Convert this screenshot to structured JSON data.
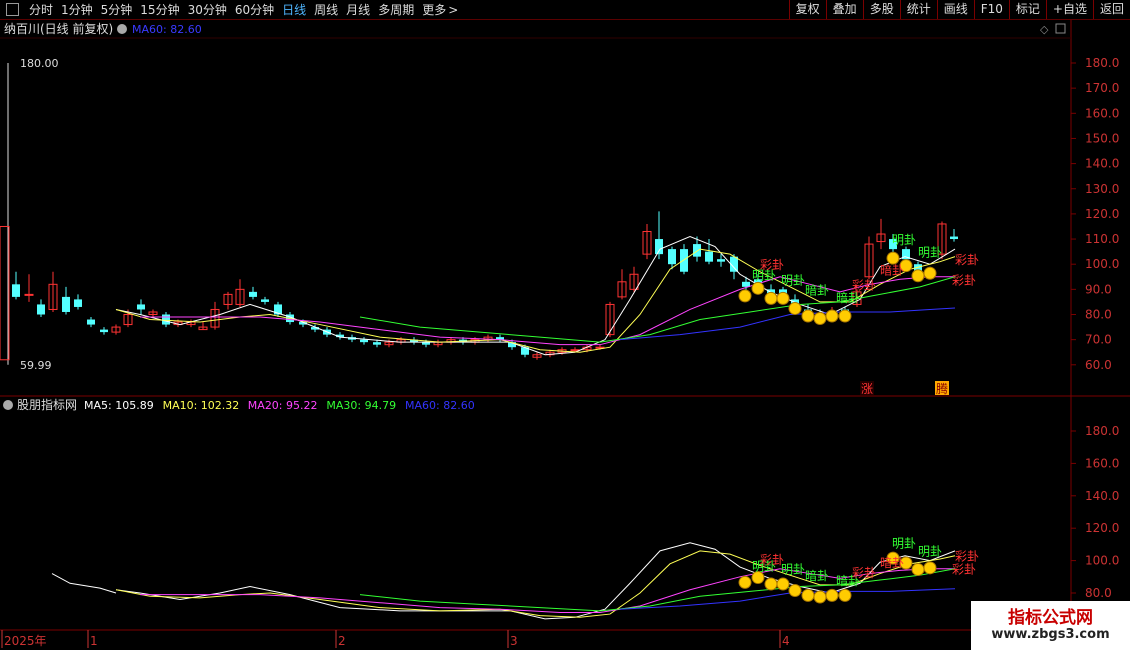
{
  "toolbar": {
    "periods": [
      "分时",
      "1分钟",
      "5分钟",
      "15分钟",
      "30分钟",
      "60分钟",
      "日线",
      "周线",
      "月线",
      "多周期",
      "更多"
    ],
    "active_period": "日线",
    "more_arrow": ">",
    "buttons": [
      "复权",
      "叠加",
      "多股",
      "统计",
      "画线",
      "F10",
      "标记",
      "+自选",
      "返回"
    ]
  },
  "main_panel": {
    "stock_title": "纳百川(日线 前复权)",
    "ma_label": "MA60: 82.60",
    "max_marker": "180.00",
    "min_marker": "59.99",
    "y_ticks": [
      "180.0",
      "170.0",
      "160.0",
      "150.0",
      "140.0",
      "130.0",
      "120.0",
      "110.0",
      "100.0",
      "90.0",
      "80.0",
      "70.0",
      "60.0"
    ],
    "tag_zhang": "涨",
    "tag_teng": "腾"
  },
  "indicator_panel": {
    "name": "股朋指标网",
    "ma_legend": [
      {
        "text": "MA5: 105.89",
        "color": "#ffffff"
      },
      {
        "text": "MA10: 102.32",
        "color": "#ffff55"
      },
      {
        "text": "MA20: 95.22",
        "color": "#ff44ff"
      },
      {
        "text": "MA30: 94.79",
        "color": "#33ff33"
      },
      {
        "text": "MA60: 82.60",
        "color": "#3333ff"
      }
    ],
    "y_ticks": [
      "180.0",
      "160.0",
      "140.0",
      "120.0",
      "100.0",
      "80.0"
    ]
  },
  "time_axis": {
    "labels": [
      "2025年",
      "1",
      "2",
      "3",
      "4"
    ]
  },
  "signals": {
    "ming": "明卦",
    "an": "暗卦",
    "cai": "彩卦"
  },
  "watermark": {
    "line1": "指标公式网",
    "line2": "www.zbgs3.com"
  },
  "colors": {
    "up": "#ff3333",
    "down": "#54ffff",
    "grid": "#7a0000",
    "axis_text": "#cc3333"
  },
  "chart_data": {
    "type": "line",
    "title": "纳百川(日线 前复权)",
    "ylim": [
      55,
      190
    ],
    "series": [
      {
        "name": "MA5",
        "values": [
          null,
          null,
          null,
          null,
          null,
          null,
          null,
          null,
          null,
          null,
          null,
          null,
          null,
          null,
          null,
          null,
          null,
          null,
          null,
          null,
          null,
          null,
          null,
          null,
          null,
          null,
          null,
          null,
          null,
          null,
          null,
          null,
          null,
          null,
          null,
          null,
          null,
          null,
          null,
          null,
          null,
          null,
          null,
          null,
          null,
          null,
          null,
          null,
          null,
          null,
          null,
          null,
          null,
          null,
          null,
          null,
          null,
          null,
          null,
          null,
          null,
          null,
          null,
          null,
          null,
          null,
          null,
          null,
          null,
          null,
          null,
          null,
          null,
          null,
          null,
          null,
          null,
          null,
          null,
          null,
          null,
          null,
          null,
          null,
          null,
          null,
          null,
          null,
          null,
          null,
          null
        ]
      },
      {
        "name": "MA10",
        "values": []
      },
      {
        "name": "MA20",
        "values": []
      },
      {
        "name": "MA30",
        "values": []
      },
      {
        "name": "MA60",
        "values": []
      }
    ]
  }
}
